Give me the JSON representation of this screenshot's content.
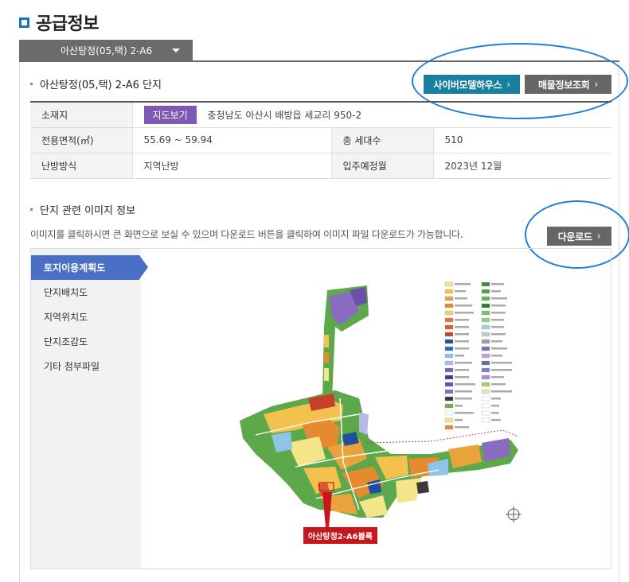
{
  "page": {
    "title": "공급정보"
  },
  "tab": {
    "label": "아산탕정(05,택) 2-A6"
  },
  "complex": {
    "heading": "아산탕정(05,택) 2-A6 단지",
    "cyber_button": "사이버모델하우스",
    "price_button": "매물정보조회",
    "rows": {
      "location_label": "소재지",
      "map_button": "지도보기",
      "location_value": "충청남도 아산시 배방읍 세교리 950-2",
      "area_label": "전용면적(㎡)",
      "area_value": "55.69 ~ 59.94",
      "households_label": "총 세대수",
      "households_value": "510",
      "heating_label": "난방방식",
      "heating_value": "지역난방",
      "movein_label": "입주예정월",
      "movein_value": "2023년 12월"
    }
  },
  "images": {
    "heading": "단지 관련 이미지 정보",
    "description": "이미지를 클릭하시면 큰 화면으로 보실 수 있으며 다운로드 버튼을 클릭하여 이미지 파일 다운로드가 가능합니다.",
    "download_button": "다운로드",
    "nav": [
      "토지이용계획도",
      "단지배치도",
      "지역위치도",
      "단지조감도",
      "기타 첨부파일"
    ],
    "map_callout": "아산탕정2-A6블록"
  },
  "colors": {
    "accent_blue": "#1c73c3",
    "teal": "#1a7f9f",
    "purple": "#7d5bb5",
    "nav_active": "#4a6fc7",
    "callout_red": "#c8161d"
  }
}
